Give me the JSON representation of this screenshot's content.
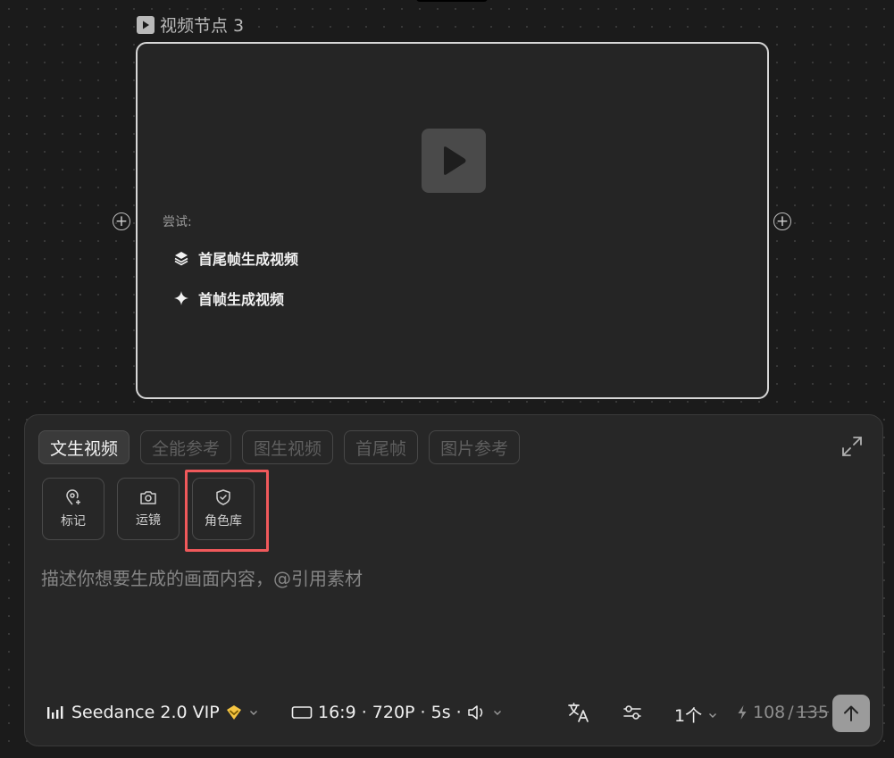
{
  "node": {
    "title": "视频节点 3",
    "try_label": "尝试:",
    "suggestions": [
      {
        "label": "首尾帧生成视频",
        "icon": "layers-icon"
      },
      {
        "label": "首帧生成视频",
        "icon": "sparkle-icon"
      }
    ]
  },
  "panel": {
    "tabs": [
      {
        "label": "文生视频",
        "active": true
      },
      {
        "label": "全能参考",
        "active": false
      },
      {
        "label": "图生视频",
        "active": false
      },
      {
        "label": "首尾帧",
        "active": false
      },
      {
        "label": "图片参考",
        "active": false
      }
    ],
    "tools": [
      {
        "label": "标记",
        "icon": "map-pin-plus-icon"
      },
      {
        "label": "运镜",
        "icon": "camera-icon"
      },
      {
        "label": "角色库",
        "icon": "shield-check-icon"
      }
    ],
    "prompt_placeholder": "描述你想要生成的画面内容，@引用素材",
    "model": {
      "name": "Seedance 2.0 VIP",
      "badge_color": "#f5c542"
    },
    "params": {
      "text": "16:9 · 720P · 5s ·"
    },
    "count": "1个",
    "cost": {
      "current": "108",
      "separator": "/",
      "original": "135"
    }
  },
  "colors": {
    "background": "#1b1b1b",
    "card": "#252525",
    "panel": "#272727",
    "highlight": "#f0595b",
    "send_button": "#9b9b9b"
  }
}
